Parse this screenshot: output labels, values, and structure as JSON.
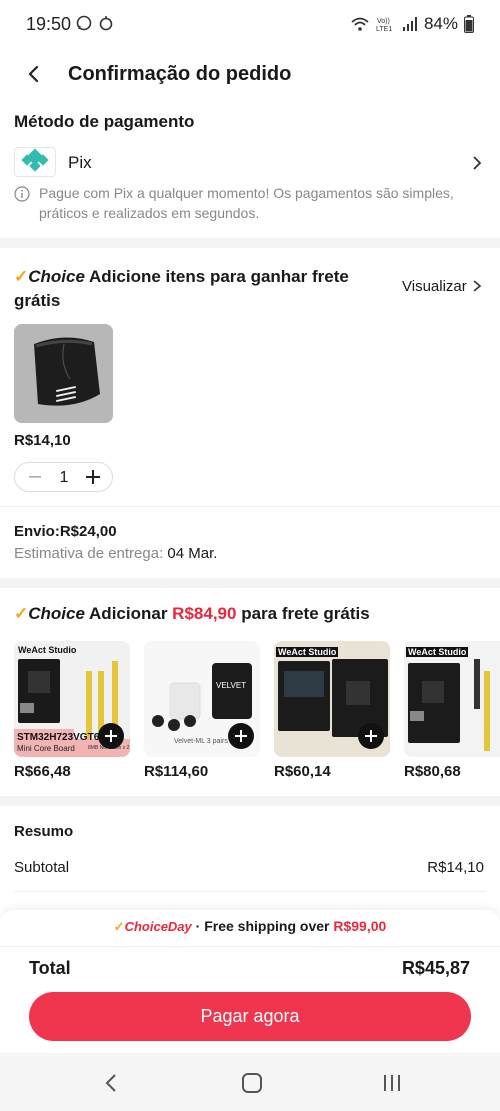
{
  "status_bar": {
    "time": "19:50",
    "battery": "84%"
  },
  "header": {
    "title": "Confirmação do pedido"
  },
  "payment": {
    "section_title": "Método de pagamento",
    "method": "Pix",
    "info": "Pague com Pix a qualquer momento! Os pagamentos são simples, práticos e realizados em segundos."
  },
  "choice_cart": {
    "brand": "Choice",
    "message": "Adicione itens para ganhar frete grátis",
    "view_label": "Visualizar",
    "item": {
      "price": "R$14,10",
      "quantity": "1"
    },
    "shipping": "Envio:R$24,00",
    "estimate_label": "Estimativa de entrega:",
    "estimate_date": "04 Mar."
  },
  "recommendations": {
    "brand": "Choice",
    "prefix": "Adicionar",
    "amount": "R$84,90",
    "suffix": "para frete grátis",
    "items": [
      {
        "price": "R$66,48",
        "brand": "WeAct Studio",
        "label": "STM32H723VGT6",
        "sublabel": "Mini Core Board",
        "extra": "8MB Nor Flash x 2"
      },
      {
        "price": "R$114,60",
        "brand": "VELVET",
        "label": "Velvet-ML 3 pairs"
      },
      {
        "price": "R$60,14",
        "brand": "WeAct Studio",
        "label": ""
      },
      {
        "price": "R$80,68",
        "brand": "WeAct Studio",
        "label": ""
      }
    ]
  },
  "summary": {
    "title": "Resumo",
    "subtotal_label": "Subtotal",
    "subtotal_value": "R$14,10"
  },
  "bottom": {
    "choice_day": "ChoiceDay",
    "free_shipping_text": "· Free shipping over",
    "free_shipping_amount": "R$99,00",
    "total_label": "Total",
    "total_value": "R$45,87",
    "pay_button": "Pagar agora"
  },
  "colors": {
    "accent": "#f0364e",
    "choice_check": "#f7a51a",
    "pix": "#32bcad"
  }
}
